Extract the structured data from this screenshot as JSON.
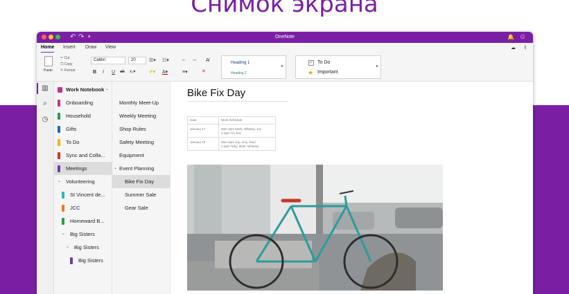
{
  "headline": "Снимок экрана",
  "window": {
    "title": "OneNote",
    "tabs": [
      "Home",
      "Insert",
      "Draw",
      "View"
    ]
  },
  "ribbon": {
    "paste_label": "Paste",
    "cut_label": "Cut",
    "copy_label": "Copy",
    "format_label": "Format",
    "font_name": "Calibri",
    "font_size": "20",
    "styles": [
      "Heading 1",
      "Heading 2"
    ],
    "tags": [
      "To Do",
      "Important"
    ]
  },
  "notebook": {
    "name": "Work Notebook",
    "sections": [
      {
        "label": "Onboarding",
        "color": "#c8318a"
      },
      {
        "label": "Household",
        "color": "#2f9a48"
      },
      {
        "label": "Gifts",
        "color": "#1e6aa8"
      },
      {
        "label": "To Do",
        "color": "#f0b500"
      },
      {
        "label": "Sync and Colla...",
        "color": "#d7312f"
      },
      {
        "label": "Meetings",
        "color": "#6a3ea8"
      }
    ],
    "groups": [
      {
        "label": "Volunteering"
      },
      {
        "label": "St Vincent de...",
        "color": "#29b8b0"
      },
      {
        "label": "JCC",
        "color": "#ee7a1e"
      },
      {
        "label": "Homeward B...",
        "color": "#2f9a48"
      },
      {
        "label": "Big Sisters"
      },
      {
        "label": "Big Sisters"
      },
      {
        "label": "Big Sisters",
        "color": "#6a3ea8"
      }
    ]
  },
  "pages": [
    "Monthly Meet-Up",
    "Weekly Meeting",
    "Shop Rules",
    "Safety Meeting",
    "Equipment",
    "Event Planning",
    "Bike Fix Day",
    "Summer Sale",
    "Gear Sale"
  ],
  "page": {
    "title": "Bike Fix Day",
    "table": {
      "headers": [
        "Date",
        "Work Schedule"
      ],
      "rows": [
        [
          "January 17",
          "9am-2pm Mark, Whitney, Joy"
        ],
        [
          "",
          "1-4pm Yo, Eric"
        ],
        [
          "January 15",
          "9am-2pm Joy, Amy, Raul"
        ],
        [
          "",
          "1-4pm Toby, Mark, Whitney"
        ]
      ]
    }
  },
  "colors": {
    "accent": "#7a1fa3"
  },
  "icons": [
    "notebooks-icon",
    "search-icon",
    "recent-icon",
    "bell-icon",
    "smiley-icon",
    "share-icon"
  ]
}
